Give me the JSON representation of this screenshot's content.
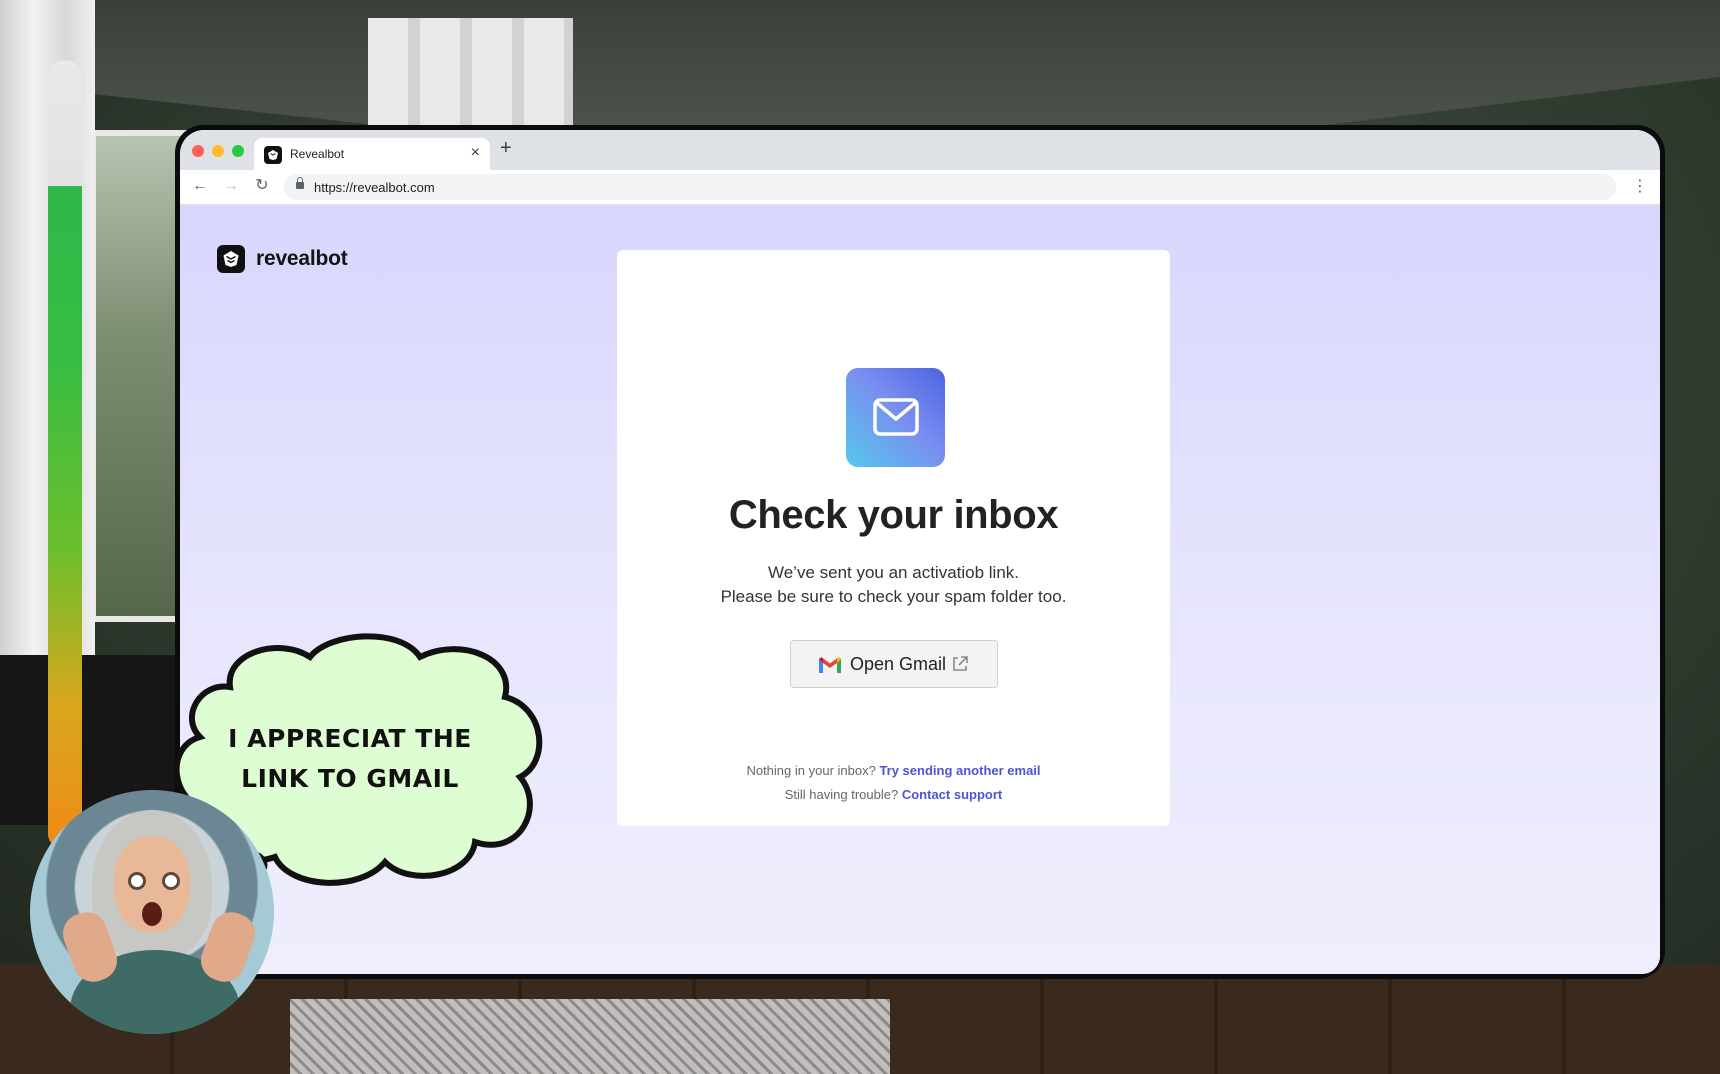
{
  "browser": {
    "tab_title": "Revealbot",
    "url": "https://revealbot.com"
  },
  "brand": {
    "name": "revealbot"
  },
  "card": {
    "title": "Check your inbox",
    "line1": "We’ve sent you an activatiob link.",
    "line2": "Please be sure to check your spam folder too.",
    "gmail_button": "Open Gmail",
    "footer1_text": "Nothing in your inbox?",
    "footer1_link": "Try sending another email",
    "footer2_text": "Still having trouble?",
    "footer2_link": "Contact support"
  },
  "reviewer": {
    "thought": "I appreciat the link to gmail",
    "meter_level": 0.84
  },
  "colors": {
    "page_bg": "#dcdafd",
    "link": "#4b55d6",
    "bubble": "#dffdd2"
  },
  "icons": {
    "tab_favicon": "revealbot-logo-icon",
    "mail": "envelope-icon",
    "gmail": "gmail-icon",
    "external": "external-link-icon"
  }
}
